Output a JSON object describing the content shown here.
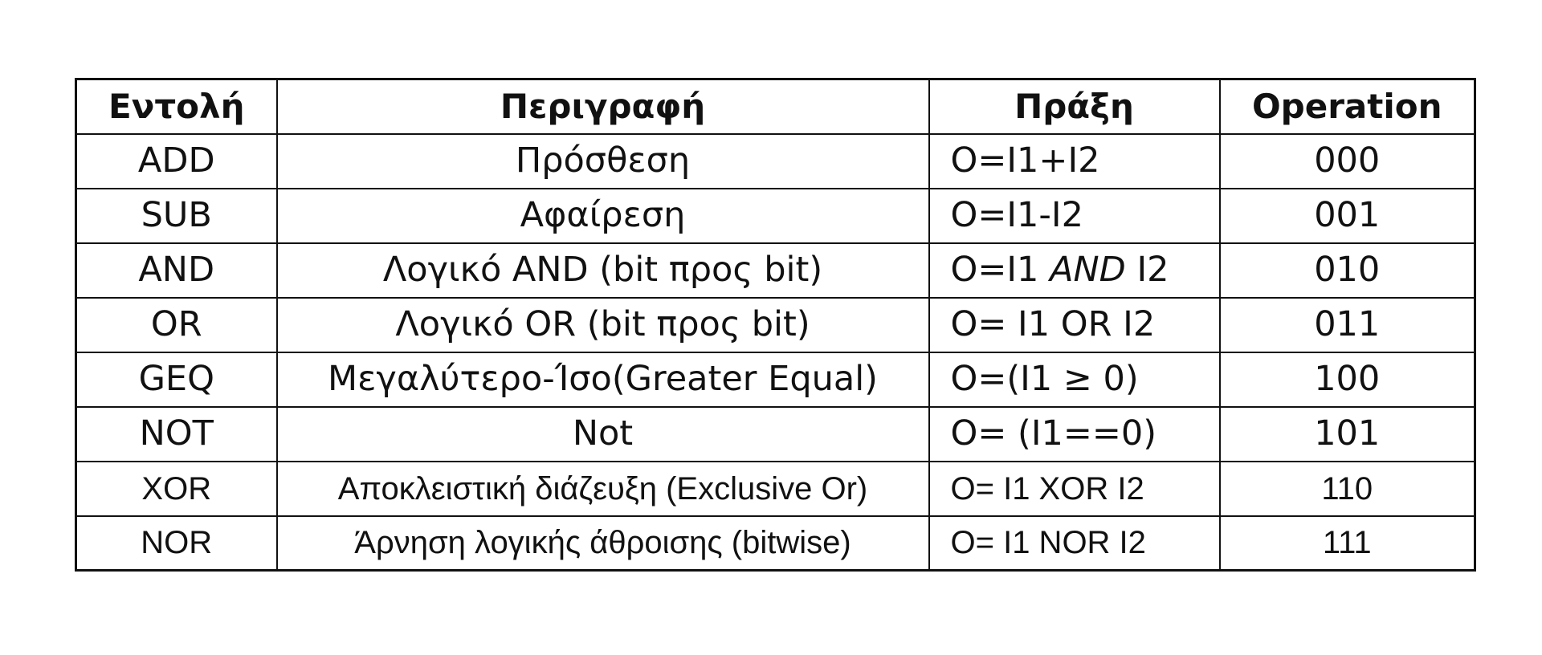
{
  "table": {
    "headers": {
      "command": "Εντολή",
      "description": "Περιγραφή",
      "action": "Πράξη",
      "operation": "Operation"
    },
    "rows": [
      {
        "command": "ADD",
        "description": "Πρόσθεση",
        "action": "O=I1+I2",
        "code": "000"
      },
      {
        "command": "SUB",
        "description": "Αφαίρεση",
        "action": "O=I1-I2",
        "code": "001"
      },
      {
        "command": "AND",
        "description": "Λογικό AND (bit προς bit)",
        "action_prefix": "O=I1 ",
        "action_op": "AND",
        "action_suffix": " I2",
        "code": "010"
      },
      {
        "command": "OR",
        "description": "Λογικό OR (bit προς bit)",
        "action": "O= I1 OR I2",
        "code": "011"
      },
      {
        "command": "GEQ",
        "description": "Μεγαλύτερο-Ίσο(Greater Equal)",
        "action": "O=(I1 ≥ 0)",
        "code": "100"
      },
      {
        "command": "NOT",
        "description": "Not",
        "action": "O= (I1==0)",
        "code": "101"
      },
      {
        "command": "XOR",
        "description": "Αποκλειστική διάζευξη (Exclusive Or)",
        "action": "O= I1 XOR I2",
        "code": "110"
      },
      {
        "command": "NOR",
        "description": "Άρνηση λογικής άθροισης (bitwise)",
        "action": "O= I1 NOR I2",
        "code": "111"
      }
    ]
  }
}
